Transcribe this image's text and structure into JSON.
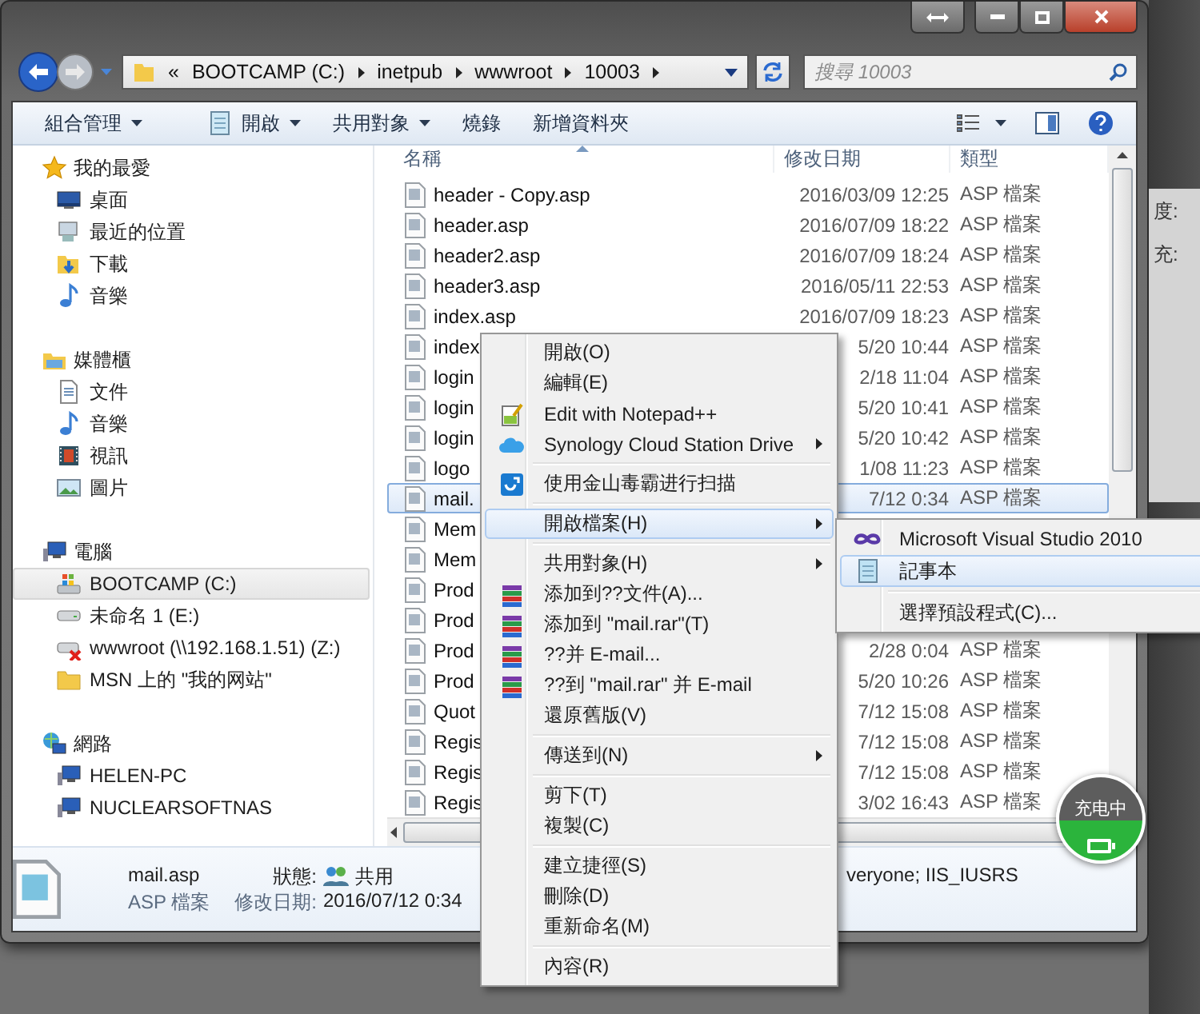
{
  "address_bar": {
    "overflow": "«",
    "crumbs": [
      "BOOTCAMP (C:)",
      "inetpub",
      "wwwroot",
      "10003"
    ]
  },
  "search": {
    "placeholder": "搜尋 10003"
  },
  "toolbar": {
    "items": [
      {
        "label": "組合管理",
        "dropdown": true
      },
      {
        "label": "開啟",
        "dropdown": true
      },
      {
        "label": "共用對象",
        "dropdown": true
      },
      {
        "label": "燒錄",
        "dropdown": false
      },
      {
        "label": "新增資料夾",
        "dropdown": false
      }
    ]
  },
  "nav": [
    {
      "label": "我的最愛",
      "children": [
        {
          "label": "桌面",
          "selected": false
        },
        {
          "label": "最近的位置",
          "selected": false
        },
        {
          "label": "下載",
          "selected": false
        },
        {
          "label": "音樂",
          "selected": false
        }
      ]
    },
    {
      "label": "媒體櫃",
      "children": [
        {
          "label": "文件",
          "selected": false
        },
        {
          "label": "音樂",
          "selected": false
        },
        {
          "label": "視訊",
          "selected": false
        },
        {
          "label": "圖片",
          "selected": false
        }
      ]
    },
    {
      "label": "電腦",
      "children": [
        {
          "label": "BOOTCAMP (C:)",
          "selected": true
        },
        {
          "label": "未命名 1 (E:)",
          "selected": false
        },
        {
          "label": "wwwroot (\\\\192.168.1.51) (Z:)",
          "selected": false
        },
        {
          "label": "MSN 上的 \"我的网站\"",
          "selected": false
        }
      ]
    },
    {
      "label": "網路",
      "children": [
        {
          "label": "HELEN-PC",
          "selected": false
        },
        {
          "label": "NUCLEARSOFTNAS",
          "selected": false
        }
      ]
    }
  ],
  "file_list": {
    "columns": [
      "名稱",
      "修改日期",
      "類型"
    ],
    "rows": [
      {
        "name": "header - Copy.asp",
        "date": "2016/03/09 12:25",
        "type": "ASP 檔案",
        "selected": false
      },
      {
        "name": "header.asp",
        "date": "2016/07/09 18:22",
        "type": "ASP 檔案",
        "selected": false
      },
      {
        "name": "header2.asp",
        "date": "2016/07/09 18:24",
        "type": "ASP 檔案",
        "selected": false
      },
      {
        "name": "header3.asp",
        "date": "2016/05/11 22:53",
        "type": "ASP 檔案",
        "selected": false
      },
      {
        "name": "index.asp",
        "date": "2016/07/09 18:23",
        "type": "ASP 檔案",
        "selected": false
      },
      {
        "name": "index",
        "date": "5/20 10:44",
        "type": "ASP 檔案",
        "selected": false
      },
      {
        "name": "login",
        "date": "2/18 11:04",
        "type": "ASP 檔案",
        "selected": false
      },
      {
        "name": "login",
        "date": "5/20 10:41",
        "type": "ASP 檔案",
        "selected": false
      },
      {
        "name": "login",
        "date": "5/20 10:42",
        "type": "ASP 檔案",
        "selected": false
      },
      {
        "name": "logo",
        "date": "1/08 11:23",
        "type": "ASP 檔案",
        "selected": false
      },
      {
        "name": "mail.",
        "date": "7/12 0:34",
        "type": "ASP 檔案",
        "selected": true
      },
      {
        "name": "Mem",
        "selected": false
      },
      {
        "name": "Mem",
        "selected": false
      },
      {
        "name": "Prod",
        "selected": false
      },
      {
        "name": "Prod",
        "selected": false
      },
      {
        "name": "Prod",
        "date": "2/28 0:04",
        "type": "ASP 檔案",
        "selected": false
      },
      {
        "name": "Prod",
        "date": "5/20 10:26",
        "type": "ASP 檔案",
        "selected": false
      },
      {
        "name": "Quot",
        "date": "7/12 15:08",
        "type": "ASP 檔案",
        "selected": false
      },
      {
        "name": "Regis",
        "date": "7/12 15:08",
        "type": "ASP 檔案",
        "selected": false
      },
      {
        "name": "Regis",
        "date": "7/12 15:08",
        "type": "ASP 檔案",
        "selected": false
      },
      {
        "name": "Regis",
        "date": "3/02 16:43",
        "type": "ASP 檔案",
        "selected": false
      }
    ]
  },
  "details": {
    "name": "mail.asp",
    "type": "ASP 檔案",
    "status_label": "狀態:",
    "status_value": "共用",
    "date_label": "修改日期:",
    "date_value": "2016/07/12 0:34",
    "shared_with": "veryone; IIS_IUSRS"
  },
  "context_menu": {
    "sections": [
      [
        {
          "label": "開啟(O)",
          "submenu": false,
          "highlighted": false
        },
        {
          "label": "編輯(E)",
          "submenu": false,
          "highlighted": false
        },
        {
          "label": "Edit with Notepad++",
          "submenu": false,
          "highlighted": false
        },
        {
          "label": "Synology Cloud Station Drive",
          "submenu": true,
          "highlighted": false
        }
      ],
      [
        {
          "label": "使用金山毒霸进行扫描",
          "submenu": false,
          "highlighted": false
        }
      ],
      [
        {
          "label": "開啟檔案(H)",
          "submenu": true,
          "highlighted": true
        }
      ],
      [
        {
          "label": "共用對象(H)",
          "submenu": true,
          "highlighted": false
        },
        {
          "label": "添加到??文件(A)...",
          "submenu": false,
          "highlighted": false
        },
        {
          "label": "添加到 \"mail.rar\"(T)",
          "submenu": false,
          "highlighted": false
        },
        {
          "label": "??并 E-mail...",
          "submenu": false,
          "highlighted": false
        },
        {
          "label": "??到 \"mail.rar\" 并 E-mail",
          "submenu": false,
          "highlighted": false
        },
        {
          "label": "還原舊版(V)",
          "submenu": false,
          "highlighted": false
        }
      ],
      [
        {
          "label": "傳送到(N)",
          "submenu": true,
          "highlighted": false
        }
      ],
      [
        {
          "label": "剪下(T)",
          "submenu": false,
          "highlighted": false
        },
        {
          "label": "複製(C)",
          "submenu": false,
          "highlighted": false
        }
      ],
      [
        {
          "label": "建立捷徑(S)",
          "submenu": false,
          "highlighted": false
        },
        {
          "label": "刪除(D)",
          "submenu": false,
          "highlighted": false
        },
        {
          "label": "重新命名(M)",
          "submenu": false,
          "highlighted": false
        }
      ],
      [
        {
          "label": "內容(R)",
          "submenu": false,
          "highlighted": false
        }
      ]
    ]
  },
  "submenu": {
    "sections": [
      [
        {
          "label": "Microsoft Visual Studio 2010",
          "highlighted": false
        },
        {
          "label": "記事本",
          "highlighted": true
        }
      ],
      [
        {
          "label": "選擇預設程式(C)...",
          "highlighted": false
        }
      ]
    ]
  },
  "background_window": {
    "labels": [
      "度:",
      "充:"
    ]
  },
  "charging_badge": {
    "label": "充电中"
  }
}
